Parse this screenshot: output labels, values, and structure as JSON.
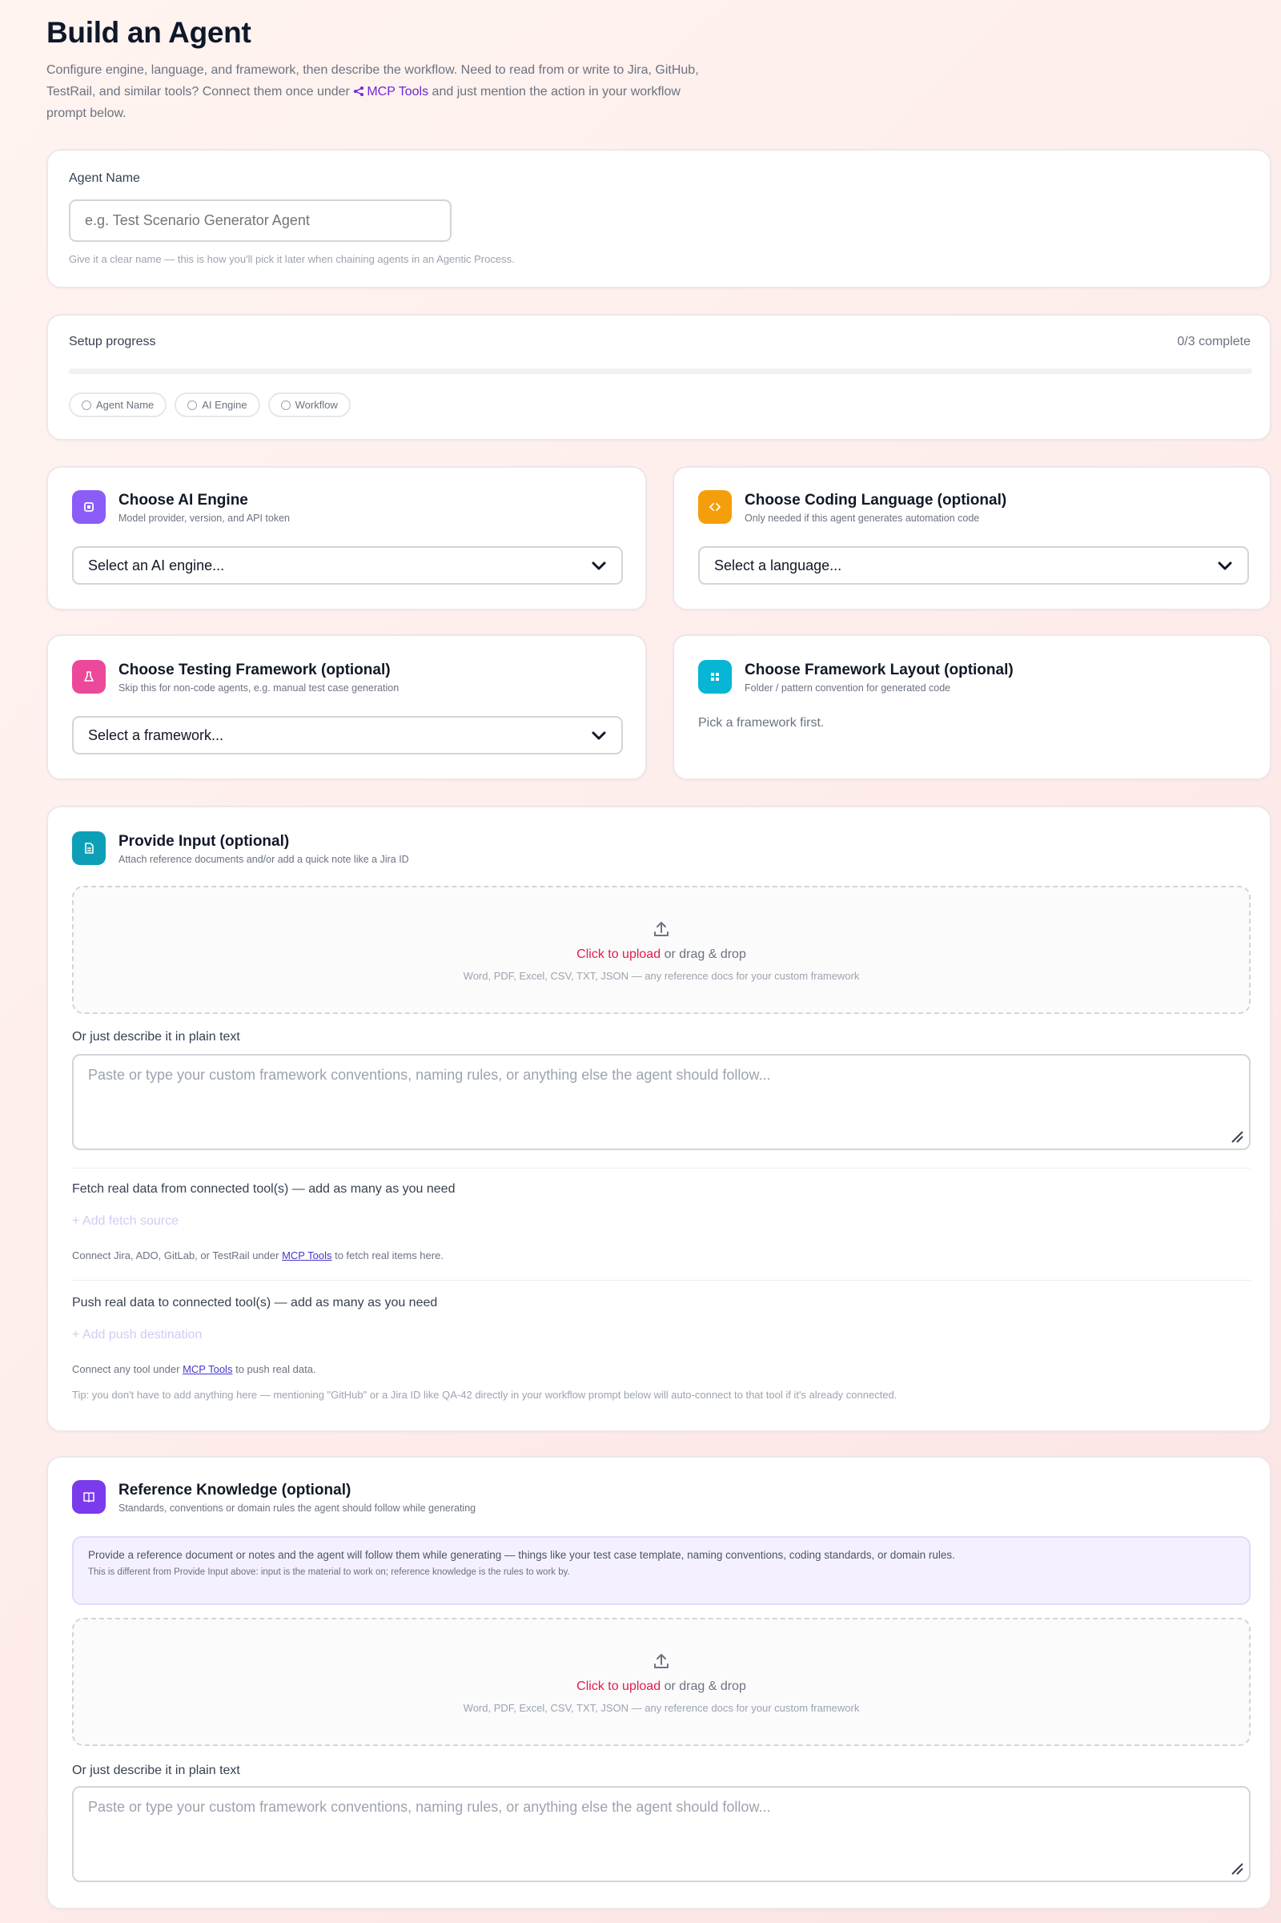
{
  "header": {
    "title": "Build an Agent",
    "intro_before": "Configure engine, language, and framework, then describe the workflow. Need to read from or write to Jira, GitHub, TestRail, and similar tools? Connect them once under",
    "intro_link": "MCP Tools",
    "intro_after": "and just mention the action in your workflow prompt below."
  },
  "agent_name": {
    "label": "Agent Name",
    "placeholder": "e.g. Test Scenario Generator Agent",
    "hint": "Give it a clear name — this is how you'll pick it later when chaining agents in an Agentic Process."
  },
  "progress": {
    "label": "Setup progress",
    "status": "0/3 complete",
    "value": 0,
    "steps": [
      "Agent Name",
      "AI Engine",
      "Workflow"
    ]
  },
  "ai_engine": {
    "title": "Choose AI Engine",
    "subtitle": "Model provider, version, and API token",
    "value": "Select an AI engine...",
    "icon": "chip-icon",
    "color": "#8b5cf6"
  },
  "coding_language": {
    "title": "Choose Coding Language (optional)",
    "subtitle": "Only needed if this agent generates automation code",
    "value": "Select a language...",
    "icon": "code-icon",
    "color": "#f59e0b"
  },
  "testing_framework": {
    "title": "Choose Testing Framework (optional)",
    "subtitle": "Skip this for non-code agents, e.g. manual test case generation",
    "value": "Select a framework...",
    "icon": "flask-icon",
    "color": "#ec4899"
  },
  "framework_layout": {
    "title": "Choose Framework Layout (optional)",
    "subtitle": "Folder / pattern convention for generated code",
    "empty_text": "Pick a framework first.",
    "icon": "grid-icon",
    "color": "#06b6d4"
  },
  "provide_input": {
    "title": "Provide Input (optional)",
    "subtitle": "Attach reference documents and/or add a quick note like a Jira ID",
    "icon": "file-icon",
    "color": "#0e9fb8",
    "upload_link": "Click to upload",
    "upload_rest": "or drag & drop",
    "upload_formats": "Word, PDF, Excel, CSV, TXT, JSON — any reference docs for your custom framework",
    "text_label": "Or just describe it in plain text",
    "text_placeholder": "Paste or type your custom framework conventions, naming rules, or anything else the agent should follow...",
    "fetch_label": "Fetch real data from connected tool(s) — add as many as you need",
    "fetch_add": "+ Add fetch source",
    "fetch_hint_before": "Connect Jira, ADO, GitLab, or TestRail under",
    "fetch_hint_link": "MCP Tools",
    "fetch_hint_after": "to fetch real items here.",
    "push_label": "Push real data to connected tool(s) — add as many as you need",
    "push_add": "+ Add push destination",
    "push_hint_before": "Connect any tool under",
    "push_hint_link": "MCP Tools",
    "push_hint_after": "to push real data.",
    "tip": "Tip: you don't have to add anything here — mentioning \"GitHub\" or a Jira ID like QA-42 directly in your workflow prompt below will auto-connect to that tool if it's already connected."
  },
  "reference": {
    "title": "Reference Knowledge (optional)",
    "subtitle": "Standards, conventions or domain rules the agent should follow while generating",
    "icon": "book-icon",
    "color": "#7c3aed",
    "note_main": "Provide a reference document or notes and the agent will follow them while generating — things like your test case template, naming conventions, coding standards, or domain rules.",
    "note_sub": "This is different from Provide Input above: input is the material to work on; reference knowledge is the rules to work by.",
    "upload_link": "Click to upload",
    "upload_rest": "or drag & drop",
    "upload_formats": "Word, PDF, Excel, CSV, TXT, JSON — any reference docs for your custom framework",
    "text_label": "Or just describe it in plain text",
    "text_placeholder": "Paste or type your custom framework conventions, naming rules, or anything else the agent should follow..."
  }
}
